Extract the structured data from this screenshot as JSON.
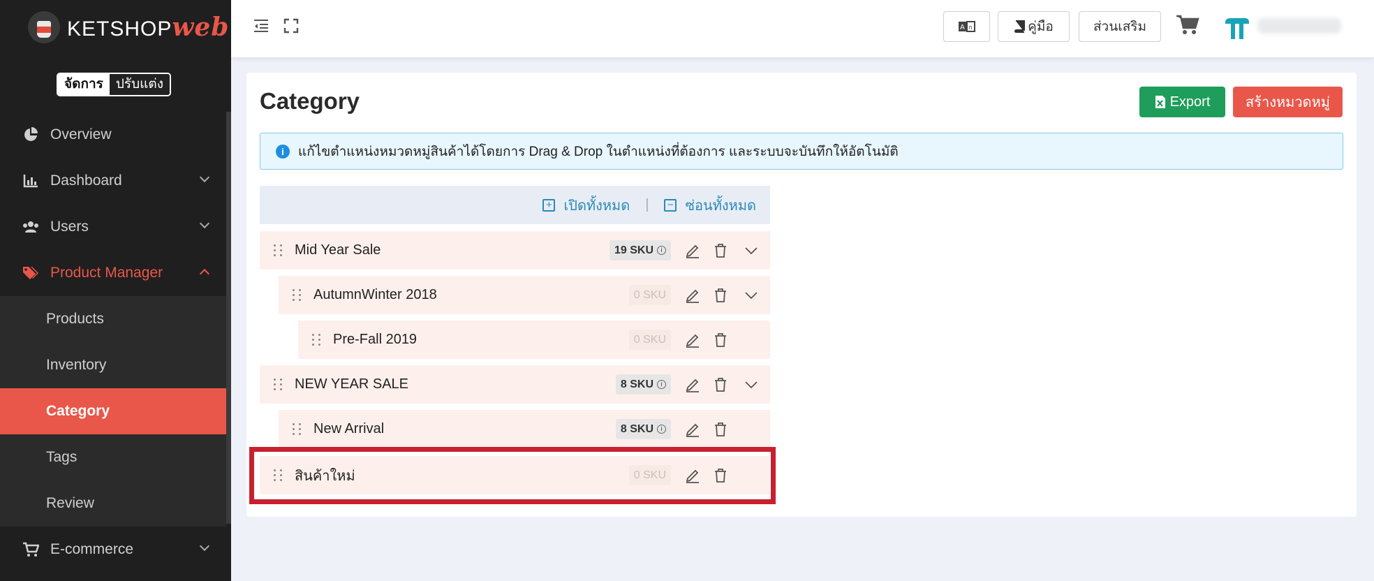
{
  "brand": {
    "name": "KETSHOP",
    "suffix": "web",
    "accent": "#e9574a"
  },
  "mode_toggle": {
    "active": "จัดการ",
    "inactive": "ปรับแต่ง"
  },
  "sidebar": {
    "items": [
      {
        "label": "Overview",
        "icon": "pie-chart-icon"
      },
      {
        "label": "Dashboard",
        "icon": "bar-chart-icon"
      },
      {
        "label": "Users",
        "icon": "users-icon"
      },
      {
        "label": "Product Manager",
        "icon": "tag-icon"
      },
      {
        "label": "E-commerce",
        "icon": "cart-icon"
      }
    ],
    "subitems": [
      "Products",
      "Inventory",
      "Category",
      "Tags",
      "Review"
    ],
    "active_subitem": "Category"
  },
  "topbar": {
    "manual_label": "คู่มือ",
    "addons_label": "ส่วนเสริม"
  },
  "page": {
    "title": "Category",
    "export_label": "Export",
    "create_label": "สร้างหมวดหมู่",
    "info_text": "แก้ไขตำแหน่งหมวดหมู่สินค้าได้โดยการ Drag & Drop ในตำแหน่งที่ต้องการ และระบบจะบันทึกให้อัตโนมัติ",
    "expand_all": "เปิดทั้งหมด",
    "collapse_all": "ซ่อนทั้งหมด"
  },
  "categories": [
    {
      "name": "Mid Year Sale",
      "sku": "19 SKU"
    },
    {
      "name": "AutumnWinter 2018",
      "sku": "0 SKU"
    },
    {
      "name": "Pre-Fall 2019",
      "sku": "0 SKU"
    },
    {
      "name": "NEW YEAR SALE",
      "sku": "8 SKU"
    },
    {
      "name": "New Arrival",
      "sku": "8 SKU"
    },
    {
      "name": "สินค้าใหม่",
      "sku": "0 SKU"
    }
  ]
}
